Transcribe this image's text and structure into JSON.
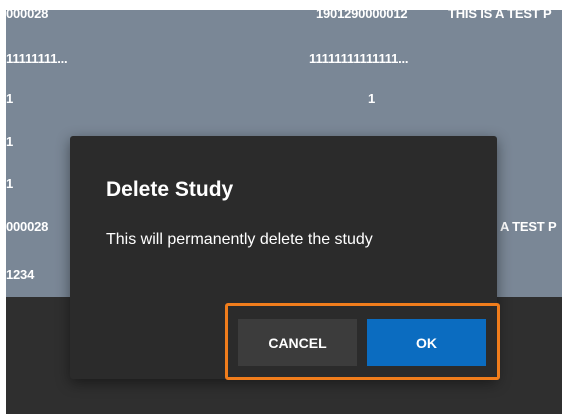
{
  "background_table": {
    "rows": [
      {
        "col1": "000028",
        "col2": "1901290000012",
        "col3": "THIS IS A TEST P"
      },
      {
        "col1": "11111111...",
        "col2": "11111111111111...",
        "col3": ""
      },
      {
        "col1": "1",
        "col2": "1",
        "col3": ""
      },
      {
        "col1": "1",
        "col2": "",
        "col3": ""
      },
      {
        "col1": "1",
        "col2": "",
        "col3": ""
      },
      {
        "col1": "000028",
        "col2": "",
        "col3": "A TEST P"
      },
      {
        "col1": "1234",
        "col2": "",
        "col3": ""
      }
    ]
  },
  "dialog": {
    "title": "Delete Study",
    "message": "This will permanently delete the study",
    "cancel_label": "CANCEL",
    "ok_label": "OK"
  },
  "colors": {
    "backdrop": "#7a8796",
    "dialog_bg": "#2b2b2b",
    "ok_button": "#0b6cc0",
    "cancel_button": "#3c3c3c",
    "highlight": "#f07d1c"
  }
}
